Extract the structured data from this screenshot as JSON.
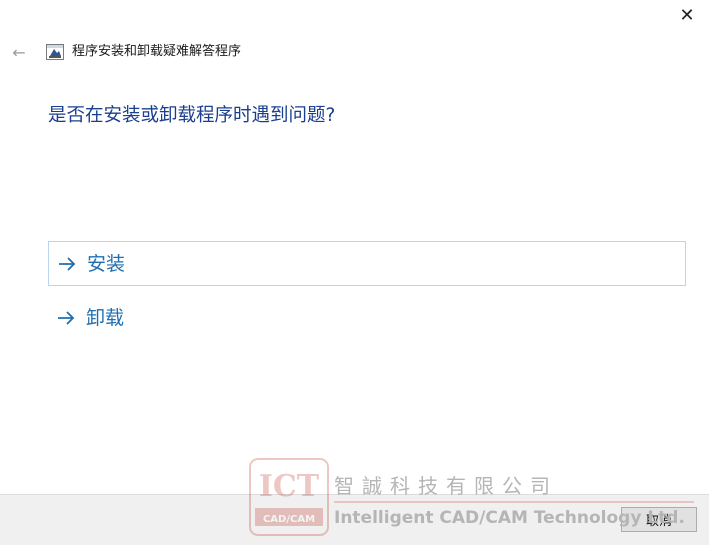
{
  "window": {
    "title": "程序安装和卸载疑难解答程序",
    "close_glyph": "✕",
    "back_glyph": "←"
  },
  "main": {
    "question": "是否在安装或卸载程序时遇到问题?",
    "options": [
      {
        "label": "安装",
        "arrow": "→"
      },
      {
        "label": "卸载",
        "arrow": "→"
      }
    ]
  },
  "footer": {
    "cancel_label": "取消"
  },
  "watermark": {
    "logo_text": "ICT",
    "logo_sub": "CAD/CAM",
    "company_cn": "智誠科技有限公司",
    "company_en": "Intelligent CAD/CAM Technology Ltd."
  },
  "colors": {
    "question": "#1b3f8f",
    "link": "#1f6fb2",
    "hover_border": "#b9d5ef",
    "footer_bg": "#f0f0f0",
    "watermark_red": "#c0392b"
  },
  "icons": {
    "close": "close-icon",
    "back": "back-arrow-icon",
    "app": "troubleshooter-app-icon",
    "option_arrow": "arrow-right-icon"
  }
}
